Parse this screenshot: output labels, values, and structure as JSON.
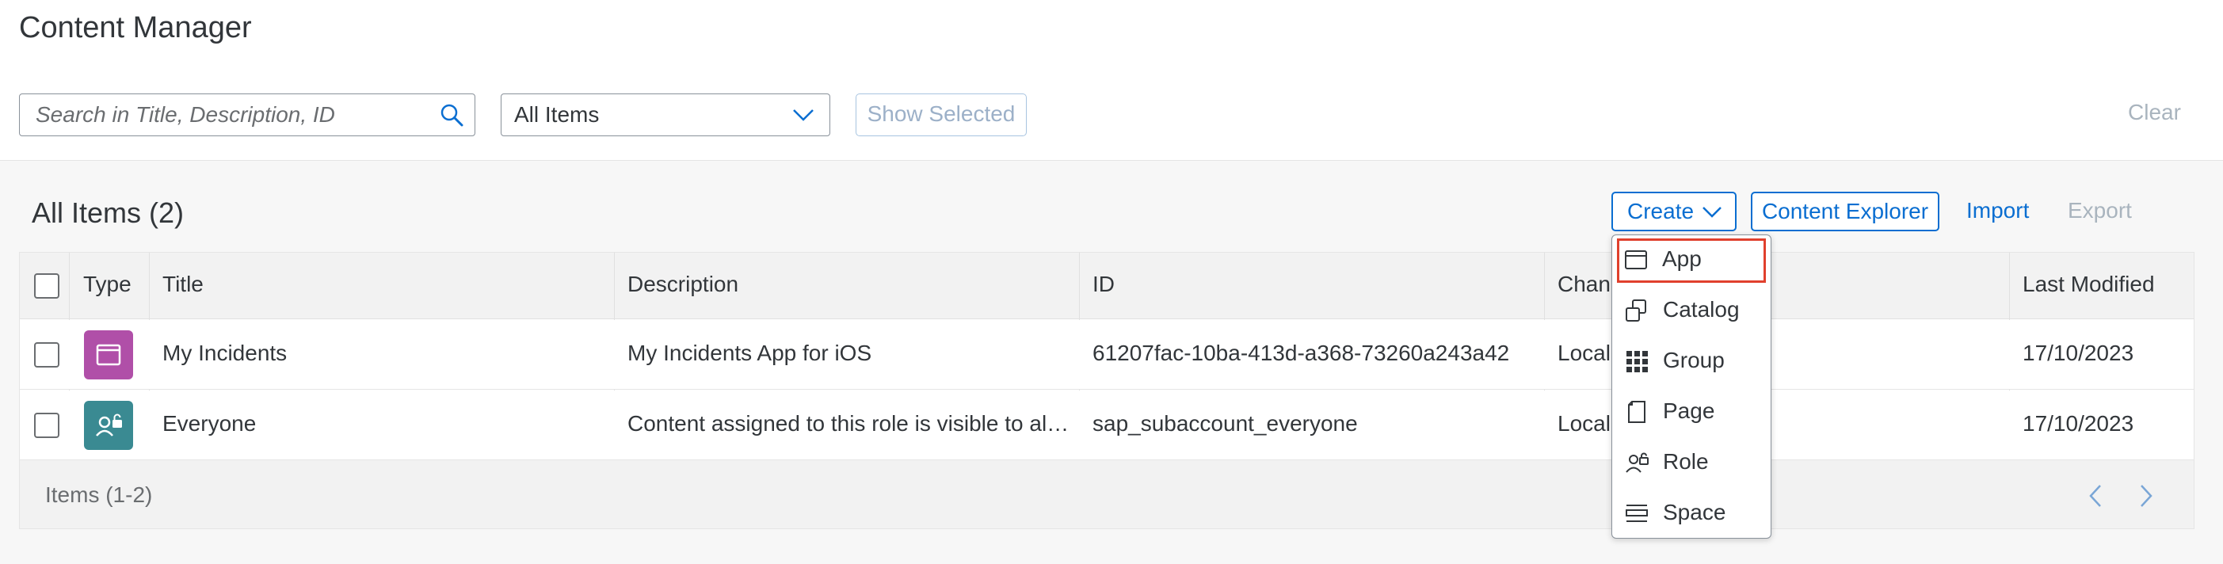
{
  "header": {
    "title": "Content Manager",
    "search_placeholder": "Search in Title, Description, ID",
    "filter_value": "All Items",
    "show_selected_label": "Show Selected",
    "clear_label": "Clear"
  },
  "toolbar": {
    "items_title": "All Items (2)",
    "create_label": "Create",
    "content_explorer_label": "Content Explorer",
    "import_label": "Import",
    "export_label": "Export"
  },
  "table": {
    "columns": [
      "Type",
      "Title",
      "Description",
      "ID",
      "Changed On",
      "Last Modified"
    ],
    "column_visible": {
      "changed": "Chan"
    },
    "rows": [
      {
        "type_icon": "app-icon",
        "title": "My Incidents",
        "description": "My Incidents App for iOS",
        "id": "61207fac-10ba-413d-a368-73260a243a42",
        "changed": "Local",
        "last_modified": "17/10/2023"
      },
      {
        "type_icon": "role-icon",
        "title": "Everyone",
        "description": "Content assigned to this role is visible to al…",
        "id": "sap_subaccount_everyone",
        "changed": "Local",
        "last_modified": "17/10/2023"
      }
    ],
    "footer": "Items (1-2)"
  },
  "menu": {
    "items": [
      {
        "label": "App",
        "icon": "app-window-icon",
        "selected": true
      },
      {
        "label": "Catalog",
        "icon": "catalog-icon"
      },
      {
        "label": "Group",
        "icon": "group-grid-icon"
      },
      {
        "label": "Page",
        "icon": "page-icon"
      },
      {
        "label": "Role",
        "icon": "role-icon"
      },
      {
        "label": "Space",
        "icon": "space-icon"
      }
    ]
  },
  "colors": {
    "accent": "#0a6ed1",
    "app_icon_bg": "#b04fa8",
    "role_icon_bg": "#3a8a92",
    "selection_border": "#e0402d"
  }
}
